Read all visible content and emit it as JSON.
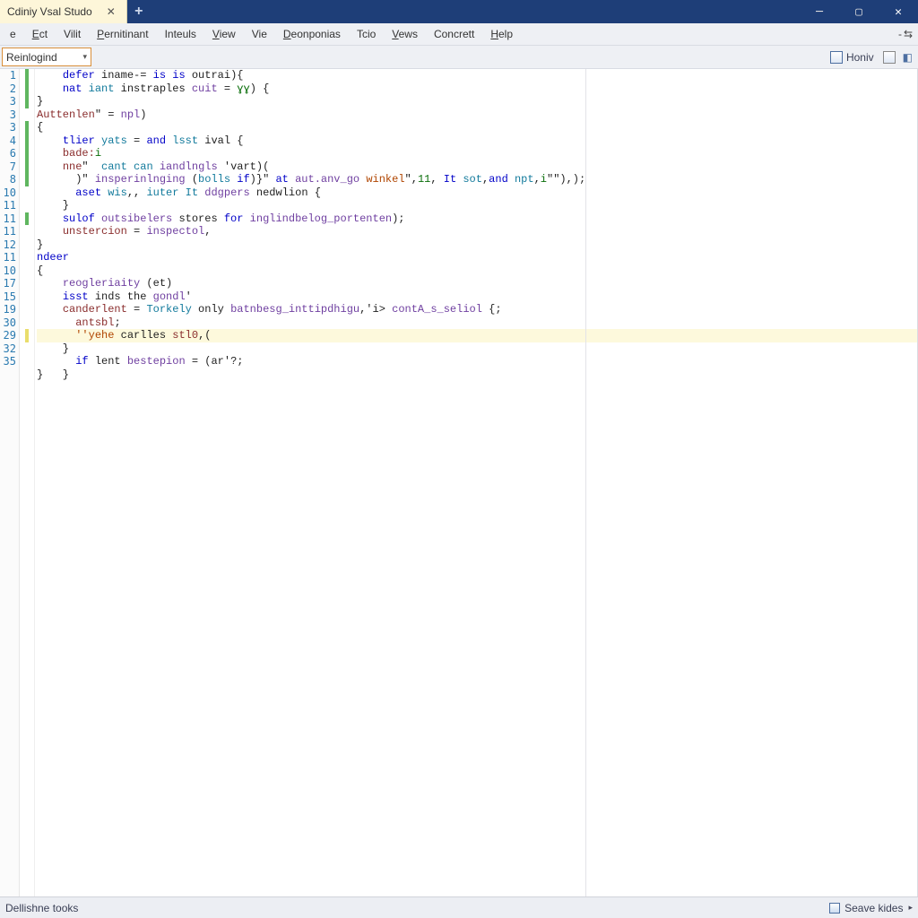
{
  "title_tab": "Cdiniy Vsal Studo",
  "menus": [
    "e",
    "Ect",
    "Vilit",
    "Pernitinant",
    "Inteuls",
    "View",
    "Vie",
    "Deonponias",
    "Tcio",
    "Vews",
    "Concrett",
    "Help"
  ],
  "menu_underline_index": [
    -1,
    0,
    -1,
    0,
    -1,
    0,
    -1,
    0,
    -1,
    0,
    -1,
    0
  ],
  "menu_right_dash": "-",
  "menu_right_glyph": "⇆",
  "combo_value": "Reinlogind",
  "tool_home_label": "Honiv",
  "gutter_lines": [
    "1",
    "2",
    "3",
    "3",
    "3",
    "4",
    "6",
    "7",
    "8",
    "10",
    "11",
    "11",
    "11",
    "12",
    "11",
    "10",
    "17",
    "15",
    "19",
    "30",
    "29",
    "32",
    "35"
  ],
  "margin_marks": [
    "g",
    "g",
    "g",
    "",
    "g",
    "g",
    "g",
    "g",
    "g",
    "",
    "",
    "g",
    "",
    "",
    "",
    "",
    "",
    "",
    "",
    "",
    "y",
    "",
    ""
  ],
  "code_lines": [
    [
      [
        "    ",
        ""
      ],
      [
        "defer",
        "kw"
      ],
      [
        " iname-= ",
        "op"
      ],
      [
        "is",
        "kw"
      ],
      [
        " ",
        "op"
      ],
      [
        "is",
        "kw"
      ],
      [
        " outrai){",
        ""
      ]
    ],
    [
      [
        "    ",
        ""
      ],
      [
        "nat",
        "kw"
      ],
      [
        " ",
        ""
      ],
      [
        "iant",
        "ty"
      ],
      [
        " instraples ",
        ""
      ],
      [
        "cuit",
        "fn"
      ],
      [
        " = ",
        ""
      ],
      [
        "ɣɣ",
        "nm"
      ],
      [
        ") {",
        ""
      ]
    ],
    [
      [
        "}",
        ""
      ]
    ],
    [
      [
        "Auttenlen",
        "id"
      ],
      [
        "\" = ",
        ""
      ],
      [
        "npl",
        "fn"
      ],
      [
        ")",
        ""
      ]
    ],
    [
      [
        "{",
        ""
      ]
    ],
    [
      [
        "    ",
        ""
      ],
      [
        "tlier",
        "kw"
      ],
      [
        " ",
        ""
      ],
      [
        "yats",
        "ty"
      ],
      [
        " = ",
        ""
      ],
      [
        "and",
        "kw"
      ],
      [
        " ",
        ""
      ],
      [
        "lsst",
        "ty"
      ],
      [
        " ival {",
        ""
      ]
    ],
    [
      [
        "    ",
        ""
      ],
      [
        "bade:",
        "id"
      ],
      [
        "i",
        "nm"
      ]
    ],
    [
      [
        "    ",
        ""
      ],
      [
        "nne",
        "id"
      ],
      [
        "\"  ",
        ""
      ],
      [
        "cant",
        "ty"
      ],
      [
        " ",
        ""
      ],
      [
        "can",
        "ty"
      ],
      [
        " ",
        ""
      ],
      [
        "iandlngls",
        "fn"
      ],
      [
        " 'vart)(",
        ""
      ]
    ],
    [
      [
        "      )\" ",
        ""
      ],
      [
        "insperinlnging",
        "fn"
      ],
      [
        " (",
        ""
      ],
      [
        "bolls",
        "ty"
      ],
      [
        " ",
        ""
      ],
      [
        "if",
        "kw"
      ],
      [
        ")}\" ",
        ""
      ],
      [
        "at",
        "kw"
      ],
      [
        " ",
        ""
      ],
      [
        "aut.anv_go",
        "fn"
      ],
      [
        " ",
        ""
      ],
      [
        "winkel",
        "st"
      ],
      [
        "\",",
        ""
      ],
      [
        "11",
        "nm"
      ],
      [
        ", ",
        ""
      ],
      [
        "It",
        "kw"
      ],
      [
        " ",
        ""
      ],
      [
        "sot",
        "ty"
      ],
      [
        ",",
        ""
      ],
      [
        "and",
        "kw"
      ],
      [
        " ",
        ""
      ],
      [
        "npt",
        "ty"
      ],
      [
        ",",
        ""
      ],
      [
        "i",
        "nm"
      ],
      [
        "\"\"),);",
        ""
      ]
    ],
    [
      [
        "      ",
        ""
      ],
      [
        "aset",
        "kw"
      ],
      [
        " ",
        ""
      ],
      [
        "wis",
        "ty"
      ],
      [
        ",, ",
        ""
      ],
      [
        "iuter",
        "ty"
      ],
      [
        " ",
        ""
      ],
      [
        "It",
        "ty"
      ],
      [
        " ",
        ""
      ],
      [
        "ddgpers",
        "fn"
      ],
      [
        " nedwlion {",
        ""
      ]
    ],
    [
      [
        "    }",
        ""
      ]
    ],
    [
      [
        "    ",
        ""
      ],
      [
        "sulof",
        "kw"
      ],
      [
        " ",
        ""
      ],
      [
        "outsibelers",
        "fn"
      ],
      [
        " stores ",
        ""
      ],
      [
        "for",
        "kw"
      ],
      [
        " ",
        ""
      ],
      [
        "inglindbelog_portenten",
        "fn"
      ],
      [
        ");",
        ""
      ]
    ],
    [
      [
        "    ",
        ""
      ],
      [
        "unstercion",
        "id"
      ],
      [
        " = ",
        ""
      ],
      [
        "inspectol",
        "fn"
      ],
      [
        ",",
        ""
      ]
    ],
    [
      [
        "}",
        ""
      ]
    ],
    [
      [
        "ndeer",
        "kw"
      ]
    ],
    [
      [
        "{",
        ""
      ]
    ],
    [
      [
        "    ",
        ""
      ],
      [
        "reogleriaity",
        "fn"
      ],
      [
        " (et)",
        ""
      ]
    ],
    [
      [
        "    ",
        ""
      ],
      [
        "isst",
        "kw"
      ],
      [
        " inds the ",
        ""
      ],
      [
        "gondl",
        "fn"
      ],
      [
        "'",
        ""
      ]
    ],
    [
      [
        "    ",
        ""
      ],
      [
        "canderlent",
        "id"
      ],
      [
        " = ",
        ""
      ],
      [
        "Torkely",
        "ty"
      ],
      [
        " only ",
        ""
      ],
      [
        "batnbesg_inttipdhigu",
        "fn"
      ],
      [
        ",'i> ",
        ""
      ],
      [
        "contA_s_seliol",
        "fn"
      ],
      [
        " {;",
        ""
      ]
    ],
    [
      [
        "      ",
        ""
      ],
      [
        "antsbl",
        "id"
      ],
      [
        ";",
        ""
      ]
    ],
    [
      [
        "      ",
        ""
      ],
      [
        "''yehe",
        "st"
      ],
      [
        " carlles ",
        ""
      ],
      [
        "stl0",
        "id"
      ],
      [
        ",(",
        ""
      ]
    ],
    [
      [
        "    }",
        ""
      ]
    ],
    [
      [
        "      ",
        ""
      ],
      [
        "if",
        "kw"
      ],
      [
        " lent ",
        ""
      ],
      [
        "bestepion",
        "fn"
      ],
      [
        " = (ar'?;",
        ""
      ]
    ],
    [
      [
        "}   }",
        ""
      ]
    ]
  ],
  "highlight_row": 20,
  "status_left": "Dellishne tooks",
  "status_right": "Seave kides"
}
